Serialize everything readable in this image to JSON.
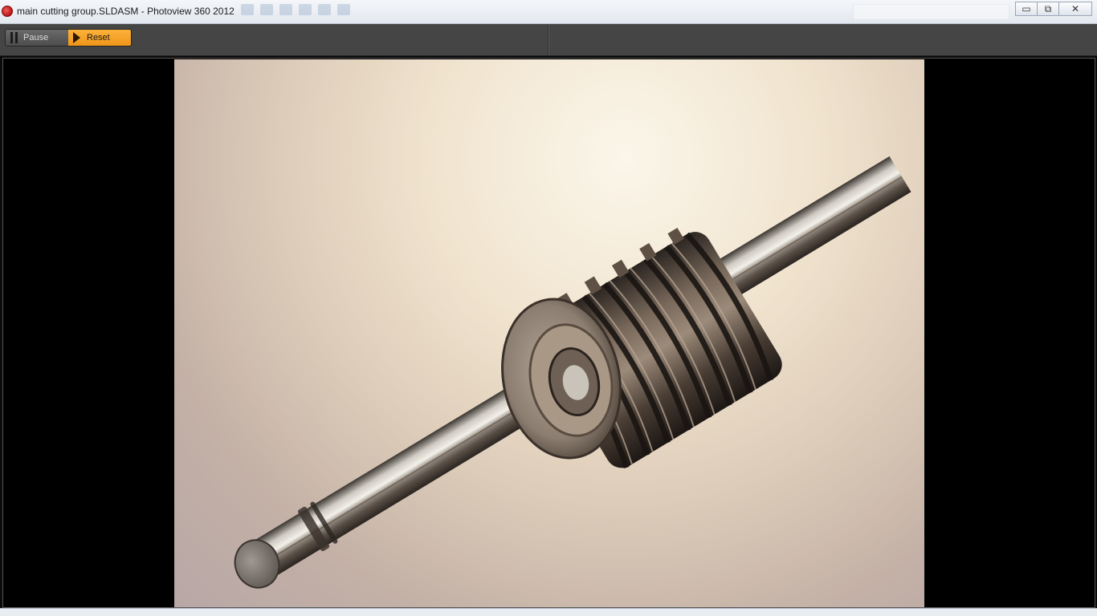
{
  "window": {
    "title": "main cutting group.SLDASM - Photoview 360 2012",
    "background_title": "main cutting group.SLDASM *",
    "minimize": "▭",
    "maximize": "⧉",
    "close": "✕"
  },
  "toolbar": {
    "pause_label": "Pause",
    "reset_label": "Reset",
    "reset_color": "#f6a327"
  },
  "viewport": {
    "content": "rendered 3D model: helical cutter (hob) on a shaft"
  }
}
